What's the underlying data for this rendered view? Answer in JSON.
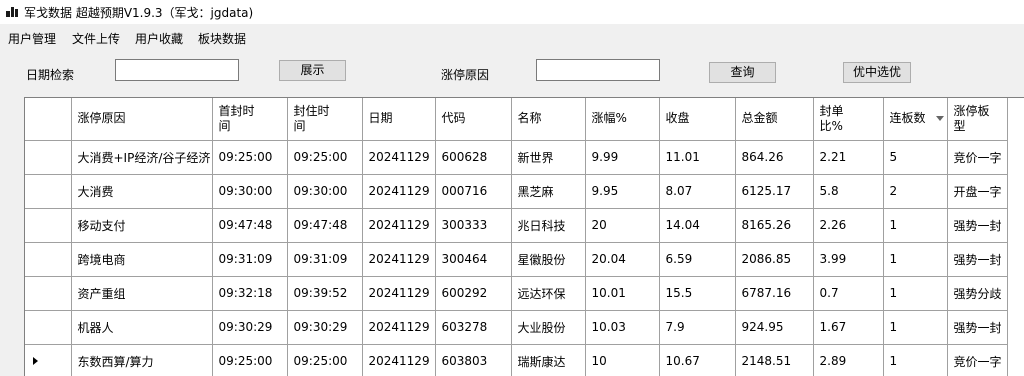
{
  "window": {
    "title": "军戈数据 超越预期V1.9.3（军戈：jgdata)"
  },
  "menu": [
    {
      "label": "用户管理"
    },
    {
      "label": "文件上传"
    },
    {
      "label": "用户收藏"
    },
    {
      "label": "板块数据"
    }
  ],
  "filters": {
    "date_label": "日期检索",
    "date_value": "",
    "show_button": "展示",
    "reason_label": "涨停原因",
    "reason_value": "",
    "query_button": "查询",
    "select_button": "优中选优"
  },
  "table": {
    "columns": [
      {
        "key": "reason",
        "lines": [
          "涨停原因"
        ]
      },
      {
        "key": "first",
        "lines": [
          "首封时",
          "间"
        ]
      },
      {
        "key": "final",
        "lines": [
          "封住时",
          "间"
        ]
      },
      {
        "key": "date",
        "lines": [
          "日期"
        ]
      },
      {
        "key": "code",
        "lines": [
          "代码"
        ]
      },
      {
        "key": "name",
        "lines": [
          "名称"
        ]
      },
      {
        "key": "pct",
        "lines": [
          "涨幅%"
        ]
      },
      {
        "key": "close",
        "lines": [
          "收盘"
        ]
      },
      {
        "key": "amount",
        "lines": [
          "总金额"
        ]
      },
      {
        "key": "seal",
        "lines": [
          "封单",
          "比%"
        ]
      },
      {
        "key": "boards",
        "lines": [
          "连板数"
        ],
        "sorted": true
      },
      {
        "key": "type",
        "lines": [
          "涨停板",
          "型"
        ]
      }
    ],
    "rows": [
      {
        "reason": "大消费+IP经济/谷子经济",
        "first": "09:25:00",
        "final": "09:25:00",
        "date": "20241129",
        "code": "600628",
        "name": "新世界",
        "pct": "9.99",
        "close": "11.01",
        "amount": "864.26",
        "seal": "2.21",
        "boards": "5",
        "type": "竞价一字"
      },
      {
        "reason": "大消费",
        "first": "09:30:00",
        "final": "09:30:00",
        "date": "20241129",
        "code": "000716",
        "name": "黑芝麻",
        "pct": "9.95",
        "close": "8.07",
        "amount": "6125.17",
        "seal": "5.8",
        "boards": "2",
        "type": "开盘一字"
      },
      {
        "reason": "移动支付",
        "first": "09:47:48",
        "final": "09:47:48",
        "date": "20241129",
        "code": "300333",
        "name": "兆日科技",
        "pct": "20",
        "close": "14.04",
        "amount": "8165.26",
        "seal": "2.26",
        "boards": "1",
        "type": "强势一封"
      },
      {
        "reason": "跨境电商",
        "first": "09:31:09",
        "final": "09:31:09",
        "date": "20241129",
        "code": "300464",
        "name": "星徽股份",
        "pct": "20.04",
        "close": "6.59",
        "amount": "2086.85",
        "seal": "3.99",
        "boards": "1",
        "type": "强势一封"
      },
      {
        "reason": "资产重组",
        "first": "09:32:18",
        "final": "09:39:52",
        "date": "20241129",
        "code": "600292",
        "name": "远达环保",
        "pct": "10.01",
        "close": "15.5",
        "amount": "6787.16",
        "seal": "0.7",
        "boards": "1",
        "type": "强势分歧"
      },
      {
        "reason": "机器人",
        "first": "09:30:29",
        "final": "09:30:29",
        "date": "20241129",
        "code": "603278",
        "name": "大业股份",
        "pct": "10.03",
        "close": "7.9",
        "amount": "924.95",
        "seal": "1.67",
        "boards": "1",
        "type": "强势一封"
      },
      {
        "reason": "东数西算/算力",
        "first": "09:25:00",
        "final": "09:25:00",
        "date": "20241129",
        "code": "603803",
        "name": "瑞斯康达",
        "pct": "10",
        "close": "10.67",
        "amount": "2148.51",
        "seal": "2.89",
        "boards": "1",
        "type": "竞价一字",
        "current": true
      }
    ]
  }
}
